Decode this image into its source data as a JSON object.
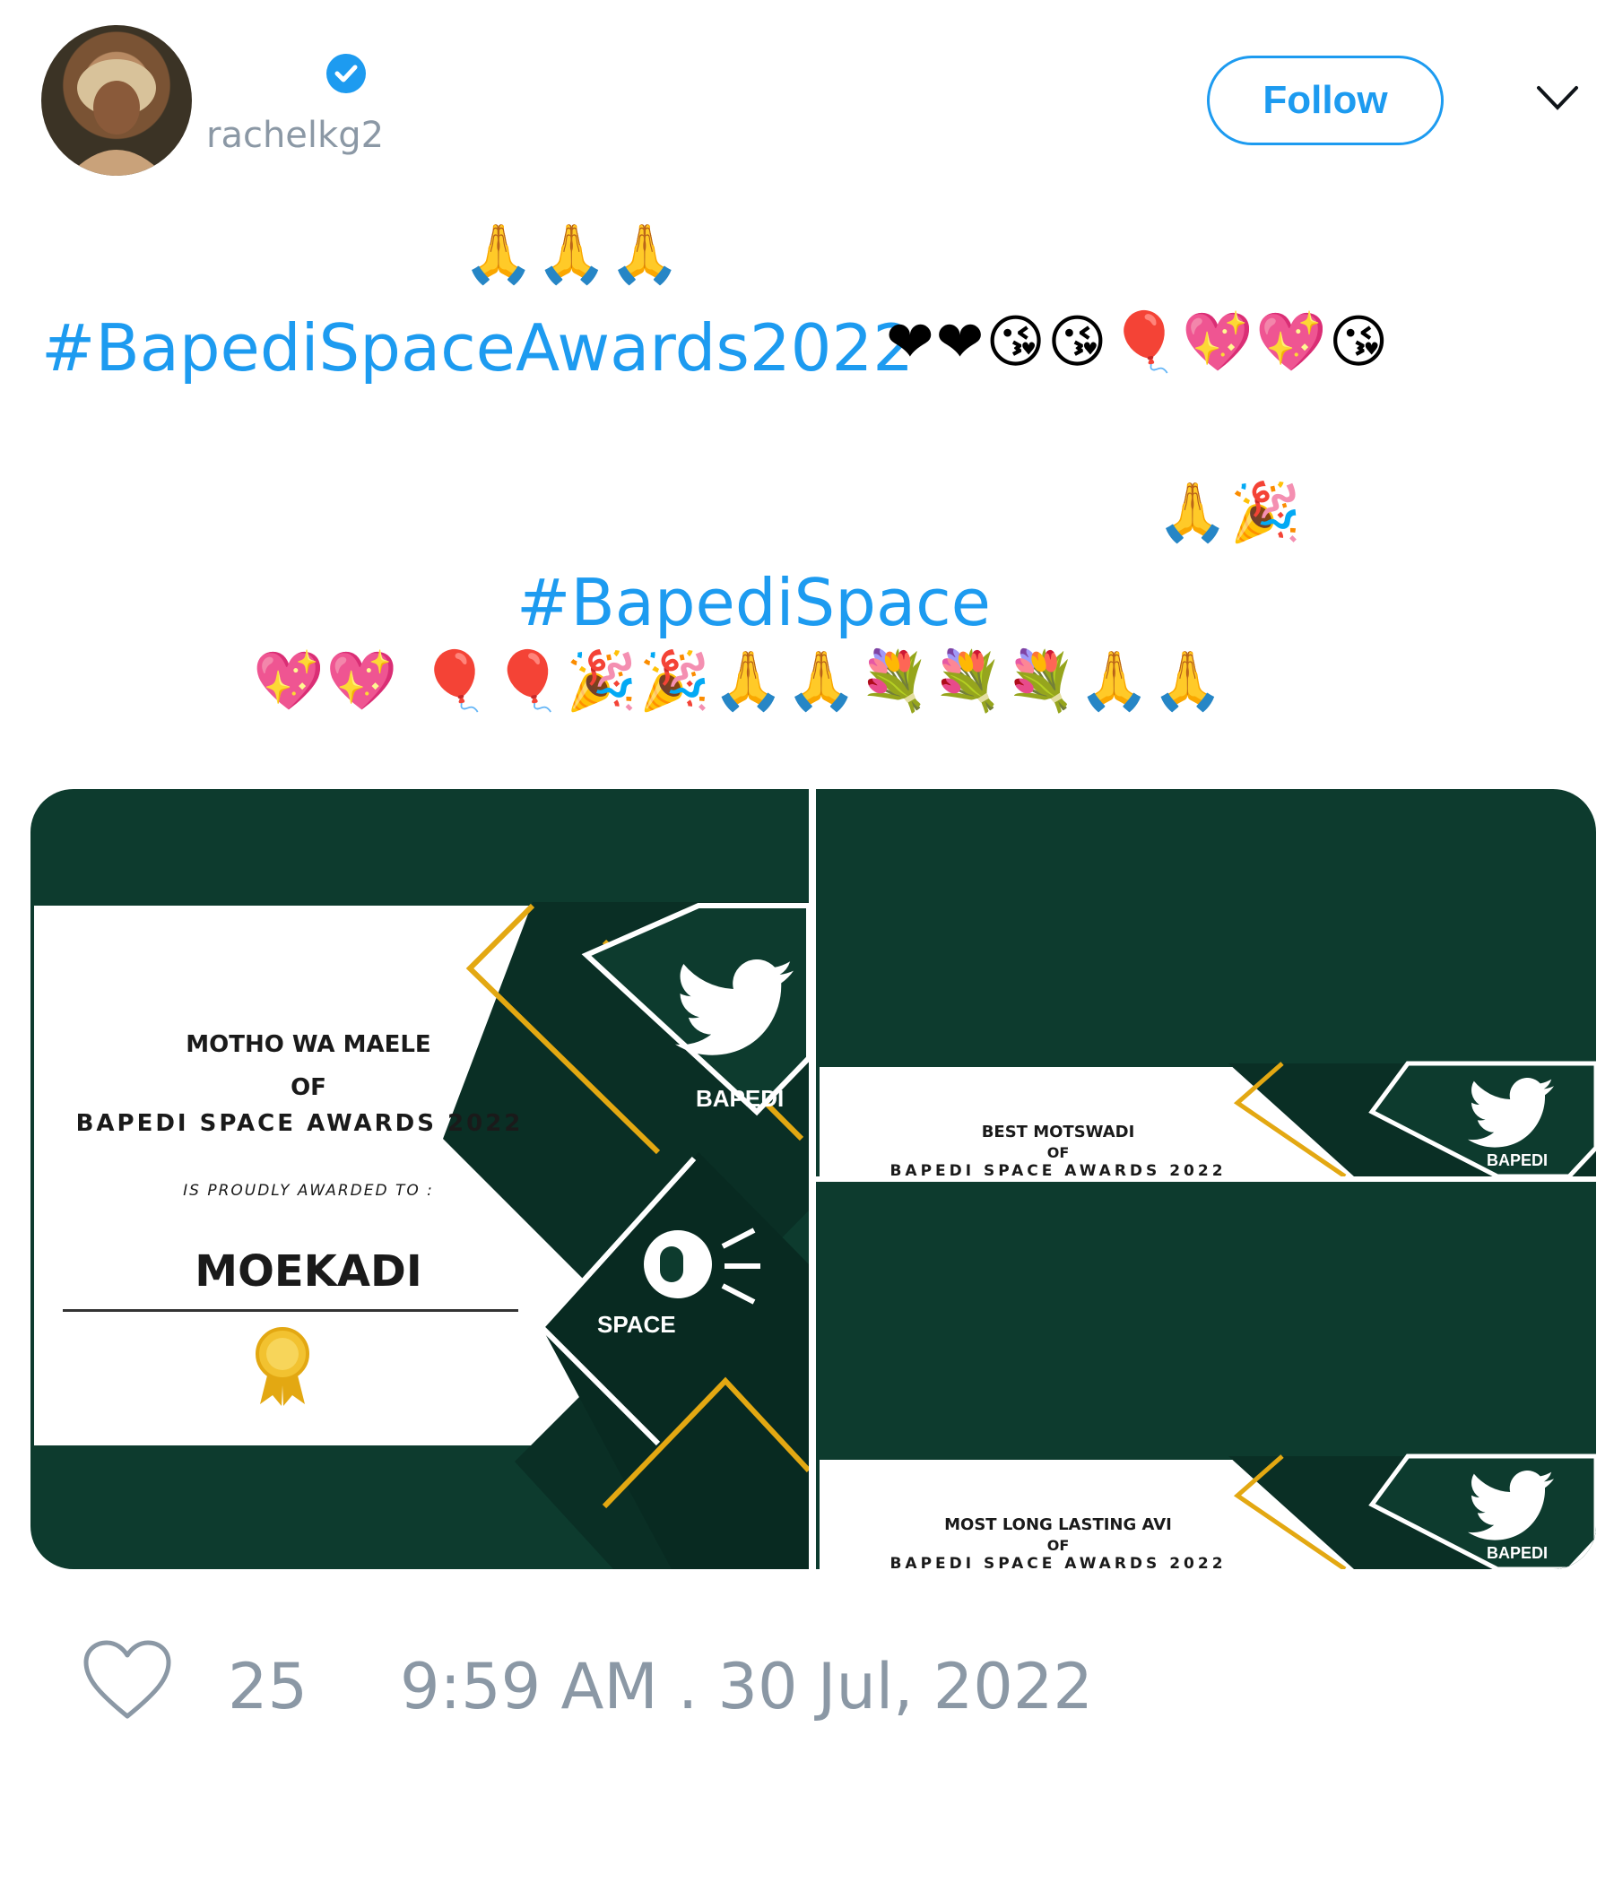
{
  "user": {
    "handle": "rachelkg2"
  },
  "header": {
    "follow_label": "Follow"
  },
  "tweet": {
    "pray_row1": "🙏🙏🙏",
    "hashtag1": "#BapediSpaceAwards2022",
    "emoji_row1": "❤❤😘😘🎈💖💖😘",
    "pray_row2": "🙏🎉",
    "hashtag2": "#BapediSpace",
    "emoji_row3": "💖💖  🎈🎈🎉🎉🙏🙏💐💐💐🙏🙏"
  },
  "media": {
    "left": {
      "title1": "MOTHO WA MAELE",
      "title2": "OF",
      "title3": "BAPEDI SPACE AWARDS 2022",
      "sub": "IS PROUDLY AWARDED TO :",
      "name": "MOEKADI",
      "bapedi_label": "BAPEDI",
      "space_label": "SPACE"
    },
    "right_top": {
      "title1": "BEST MOTSWADI",
      "title2": "OF",
      "title3": "BAPEDI SPACE AWARDS 2022",
      "bapedi_label": "BAPEDI"
    },
    "right_bottom": {
      "title1": "MOST LONG LASTING AVI",
      "title2": "OF",
      "title3": "BAPEDI SPACE AWARDS 2022",
      "bapedi_label": "BAPEDI"
    }
  },
  "footer": {
    "likes": "25",
    "timestamp": "9:59 AM . 30 Jul, 2022"
  },
  "colors": {
    "accent": "#1d9bf0",
    "muted": "#8b98a5",
    "dark_green": "#0d3b2e",
    "gold": "#e3a812"
  },
  "icons": [
    "verified-badge-icon",
    "chevron-down-icon",
    "heart-icon",
    "twitter-bird-icon",
    "microphone-icon",
    "award-ribbon-icon"
  ]
}
